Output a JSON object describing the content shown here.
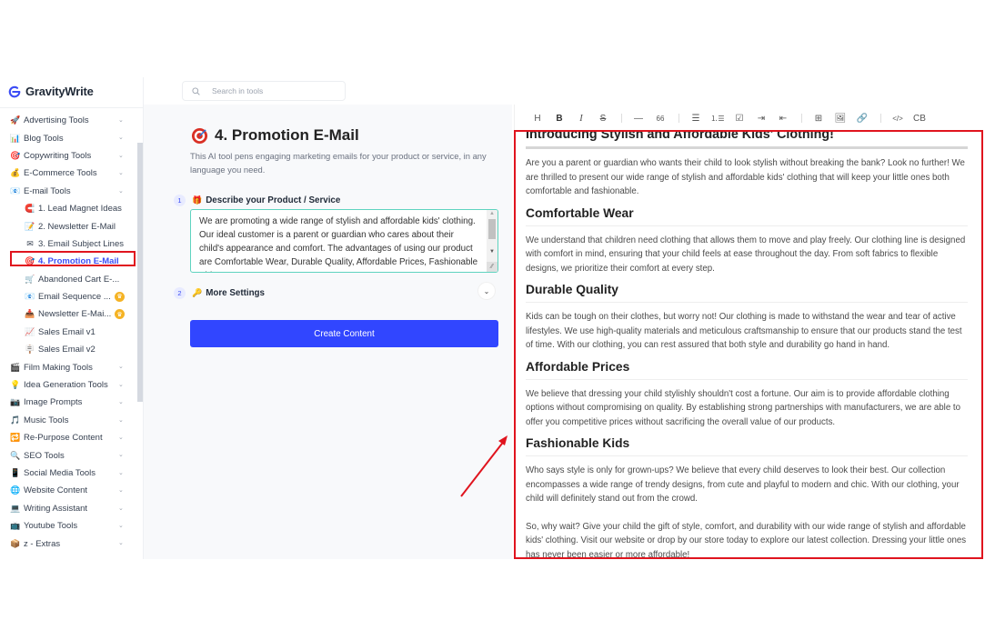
{
  "app": {
    "brand": "GravityWrite"
  },
  "search": {
    "placeholder": "Search in tools"
  },
  "sidebar": {
    "items": [
      {
        "label": "Advertising Tools",
        "icon": "rocket-icon",
        "glyph": "🚀",
        "level": "top",
        "expandable": true
      },
      {
        "label": "Blog Tools",
        "icon": "bar-chart-icon",
        "glyph": "📊",
        "level": "top",
        "expandable": true
      },
      {
        "label": "Copywriting Tools",
        "icon": "target-icon",
        "glyph": "🎯",
        "level": "top",
        "expandable": true
      },
      {
        "label": "E-Commerce Tools",
        "icon": "money-bag-icon",
        "glyph": "💰",
        "level": "top",
        "expandable": true
      },
      {
        "label": "E-mail Tools",
        "icon": "email-icon",
        "glyph": "📧",
        "level": "top",
        "expandable": true
      },
      {
        "label": "1. Lead Magnet Ideas",
        "icon": "magnet-icon",
        "glyph": "🧲",
        "level": "sub"
      },
      {
        "label": "2. Newsletter E-Mail",
        "icon": "writing-icon",
        "glyph": "📝",
        "level": "sub"
      },
      {
        "label": "3. Email Subject Lines",
        "icon": "envelope-x-icon",
        "glyph": "✉",
        "level": "sub"
      },
      {
        "label": "4. Promotion E-Mail",
        "icon": "target-icon",
        "glyph": "🎯",
        "level": "sub",
        "active": true
      },
      {
        "label": "Abandoned Cart E-...",
        "icon": "cart-icon",
        "glyph": "🛒",
        "level": "sub"
      },
      {
        "label": "Email Sequence ...",
        "icon": "email-icon",
        "glyph": "📧",
        "level": "sub",
        "premium": true
      },
      {
        "label": "Newsletter E-Mai...",
        "icon": "inbox-icon",
        "glyph": "📥",
        "level": "sub",
        "premium": true
      },
      {
        "label": "Sales Email v1",
        "icon": "chart-up-icon",
        "glyph": "📈",
        "level": "sub"
      },
      {
        "label": "Sales Email v2",
        "icon": "signpost-icon",
        "glyph": "🪧",
        "level": "sub"
      },
      {
        "label": "Film Making Tools",
        "icon": "clapper-icon",
        "glyph": "🎬",
        "level": "top",
        "expandable": true
      },
      {
        "label": "Idea Generation Tools",
        "icon": "lightbulb-icon",
        "glyph": "💡",
        "level": "top",
        "expandable": true
      },
      {
        "label": "Image Prompts",
        "icon": "camera-icon",
        "glyph": "📷",
        "level": "top",
        "expandable": true
      },
      {
        "label": "Music Tools",
        "icon": "music-icon",
        "glyph": "🎵",
        "level": "top",
        "expandable": true
      },
      {
        "label": "Re-Purpose Content",
        "icon": "repeat-icon",
        "glyph": "🔁",
        "level": "top",
        "expandable": true
      },
      {
        "label": "SEO Tools",
        "icon": "magnifier-icon",
        "glyph": "🔍",
        "level": "top",
        "expandable": true
      },
      {
        "label": "Social Media Tools",
        "icon": "phone-icon",
        "glyph": "📱",
        "level": "top",
        "expandable": true
      },
      {
        "label": "Website Content",
        "icon": "globe-icon",
        "glyph": "🌐",
        "level": "top",
        "expandable": true
      },
      {
        "label": "Writing Assistant",
        "icon": "laptop-icon",
        "glyph": "💻",
        "level": "top",
        "expandable": true
      },
      {
        "label": "Youtube Tools",
        "icon": "tv-icon",
        "glyph": "📺",
        "level": "top",
        "expandable": true
      },
      {
        "label": "z - Extras",
        "icon": "box-icon",
        "glyph": "📦",
        "level": "top",
        "expandable": true
      }
    ]
  },
  "tool": {
    "title": "4. Promotion E-Mail",
    "description": "This AI tool pens engaging marketing emails for your product or service, in any language you need.",
    "steps": [
      {
        "number": "1",
        "label": "Describe your Product / Service",
        "icon": "gift-icon",
        "glyph": "🎁"
      },
      {
        "number": "2",
        "label": "More Settings",
        "icon": "key-icon",
        "glyph": "🔑"
      }
    ],
    "product_input_value": "We are promoting a wide range of stylish and affordable kids' clothing. Our ideal customer is a parent or guardian who cares about their child's appearance and comfort. The advantages of using our product are Comfortable Wear, Durable Quality, Affordable Prices, Fashionable Kids.",
    "create_button_label": "Create Content"
  },
  "editor": {
    "toolbar": [
      {
        "name": "heading",
        "label": "H"
      },
      {
        "name": "bold",
        "label": "B"
      },
      {
        "name": "italic",
        "label": "I"
      },
      {
        "name": "strike",
        "label": "S"
      },
      {
        "sep": true
      },
      {
        "name": "horizontal-rule",
        "label": "—"
      },
      {
        "name": "quote",
        "label": "66"
      },
      {
        "sep": true
      },
      {
        "name": "bullet-list",
        "label": "☰"
      },
      {
        "name": "ordered-list",
        "label": "⒈☰"
      },
      {
        "name": "task-list",
        "label": "☑"
      },
      {
        "name": "indent",
        "label": "⇥"
      },
      {
        "name": "outdent",
        "label": "⇤"
      },
      {
        "sep": true
      },
      {
        "name": "table",
        "label": "⊞"
      },
      {
        "name": "image",
        "label": "🖼"
      },
      {
        "name": "link",
        "label": "🔗"
      },
      {
        "sep": true
      },
      {
        "name": "code",
        "label": "</>"
      },
      {
        "name": "code-block",
        "label": "CB"
      }
    ],
    "content": {
      "title": "Introducing Stylish and Affordable Kids' Clothing!",
      "intro": "Are you a parent or guardian who wants their child to look stylish without breaking the bank? Look no further! We are thrilled to present our wide range of stylish and affordable kids' clothing that will keep your little ones both comfortable and fashionable.",
      "sections": [
        {
          "heading": "Comfortable Wear",
          "body": "We understand that children need clothing that allows them to move and play freely. Our clothing line is designed with comfort in mind, ensuring that your child feels at ease throughout the day. From soft fabrics to flexible designs, we prioritize their comfort at every step."
        },
        {
          "heading": "Durable Quality",
          "body": "Kids can be tough on their clothes, but worry not! Our clothing is made to withstand the wear and tear of active lifestyles. We use high-quality materials and meticulous craftsmanship to ensure that our products stand the test of time. With our clothing, you can rest assured that both style and durability go hand in hand."
        },
        {
          "heading": "Affordable Prices",
          "body": "We believe that dressing your child stylishly shouldn't cost a fortune. Our aim is to provide affordable clothing options without compromising on quality. By establishing strong partnerships with manufacturers, we are able to offer you competitive prices without sacrificing the overall value of our products."
        },
        {
          "heading": "Fashionable Kids",
          "body": "Who says style is only for grown-ups? We believe that every child deserves to look their best. Our collection encompasses a wide range of trendy designs, from cute and playful to modern and chic. With our clothing, your child will definitely stand out from the crowd."
        }
      ],
      "closing": "So, why wait? Give your child the gift of style, comfort, and durability with our wide range of stylish and affordable kids' clothing. Visit our website or drop by our store today to explore our latest collection. Dressing your little ones has never been easier or more affordable!"
    }
  },
  "colors": {
    "accent": "#3146ff",
    "active_text": "#3b4cf5",
    "annotation": "#e0141e",
    "input_border": "#5fd3bf",
    "premium": "#f5b324"
  }
}
